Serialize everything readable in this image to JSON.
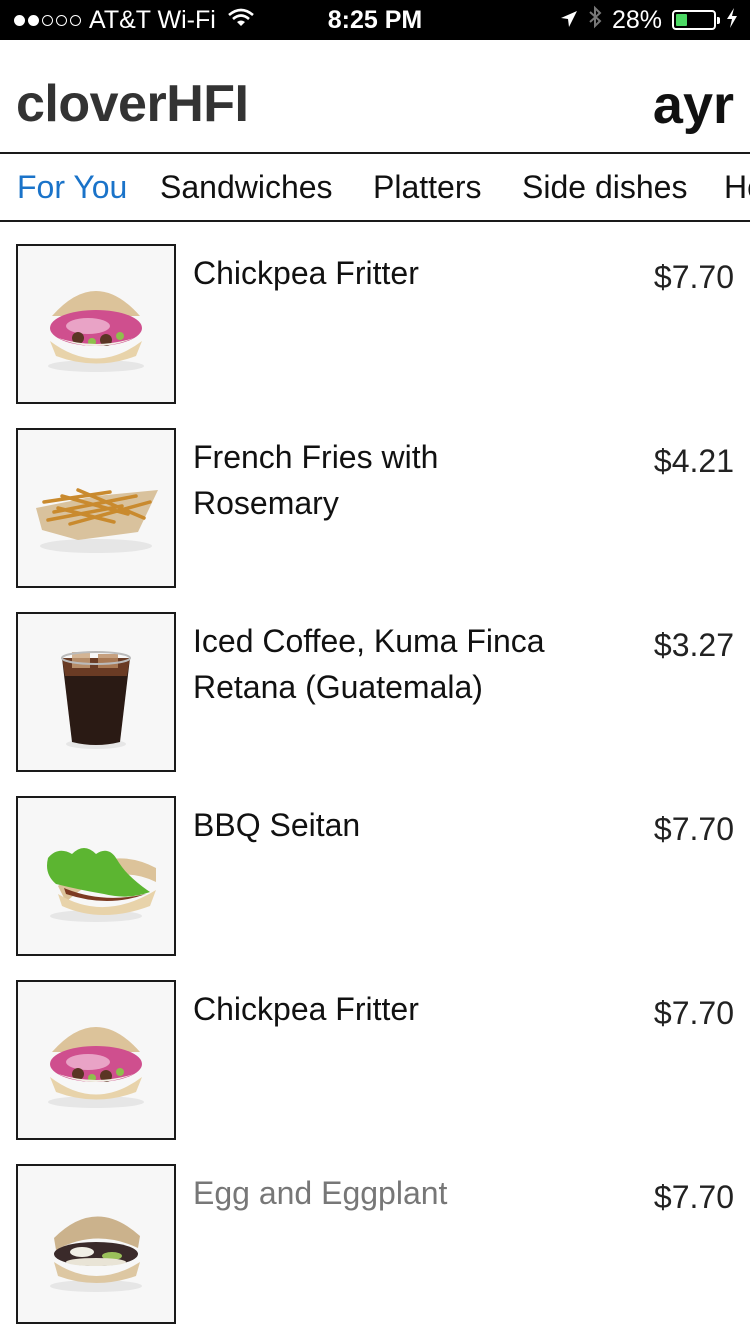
{
  "status_bar": {
    "carrier": "AT&T Wi-Fi",
    "time": "8:25 PM",
    "battery": "28%",
    "signal_dots_filled": 2,
    "signal_dots_total": 5
  },
  "header": {
    "brand": "cloverHFI",
    "user": "ayr"
  },
  "tabs": [
    {
      "label": "For You",
      "active": true
    },
    {
      "label": "Sandwiches",
      "active": false
    },
    {
      "label": "Platters",
      "active": false
    },
    {
      "label": "Side dishes",
      "active": false
    },
    {
      "label": "Ho",
      "active": false
    }
  ],
  "menu_items": [
    {
      "name": "Chickpea Fritter",
      "price": "$7.70",
      "image": "sandwich-pink"
    },
    {
      "name": "French Fries with Rosemary",
      "price": "$4.21",
      "image": "fries"
    },
    {
      "name": "Iced Coffee, Kuma Finca Retana (Guatemala)",
      "price": "$3.27",
      "image": "iced-coffee"
    },
    {
      "name": "BBQ Seitan",
      "price": "$7.70",
      "image": "sandwich-lettuce"
    },
    {
      "name": "Chickpea Fritter",
      "price": "$7.70",
      "image": "sandwich-pink"
    },
    {
      "name": "Egg and Eggplant",
      "price": "$7.70",
      "image": "sandwich-eggplant"
    }
  ],
  "colors": {
    "accent": "#1a73c9",
    "status_bar_bg": "#000000",
    "battery_fill": "#4cd964"
  }
}
